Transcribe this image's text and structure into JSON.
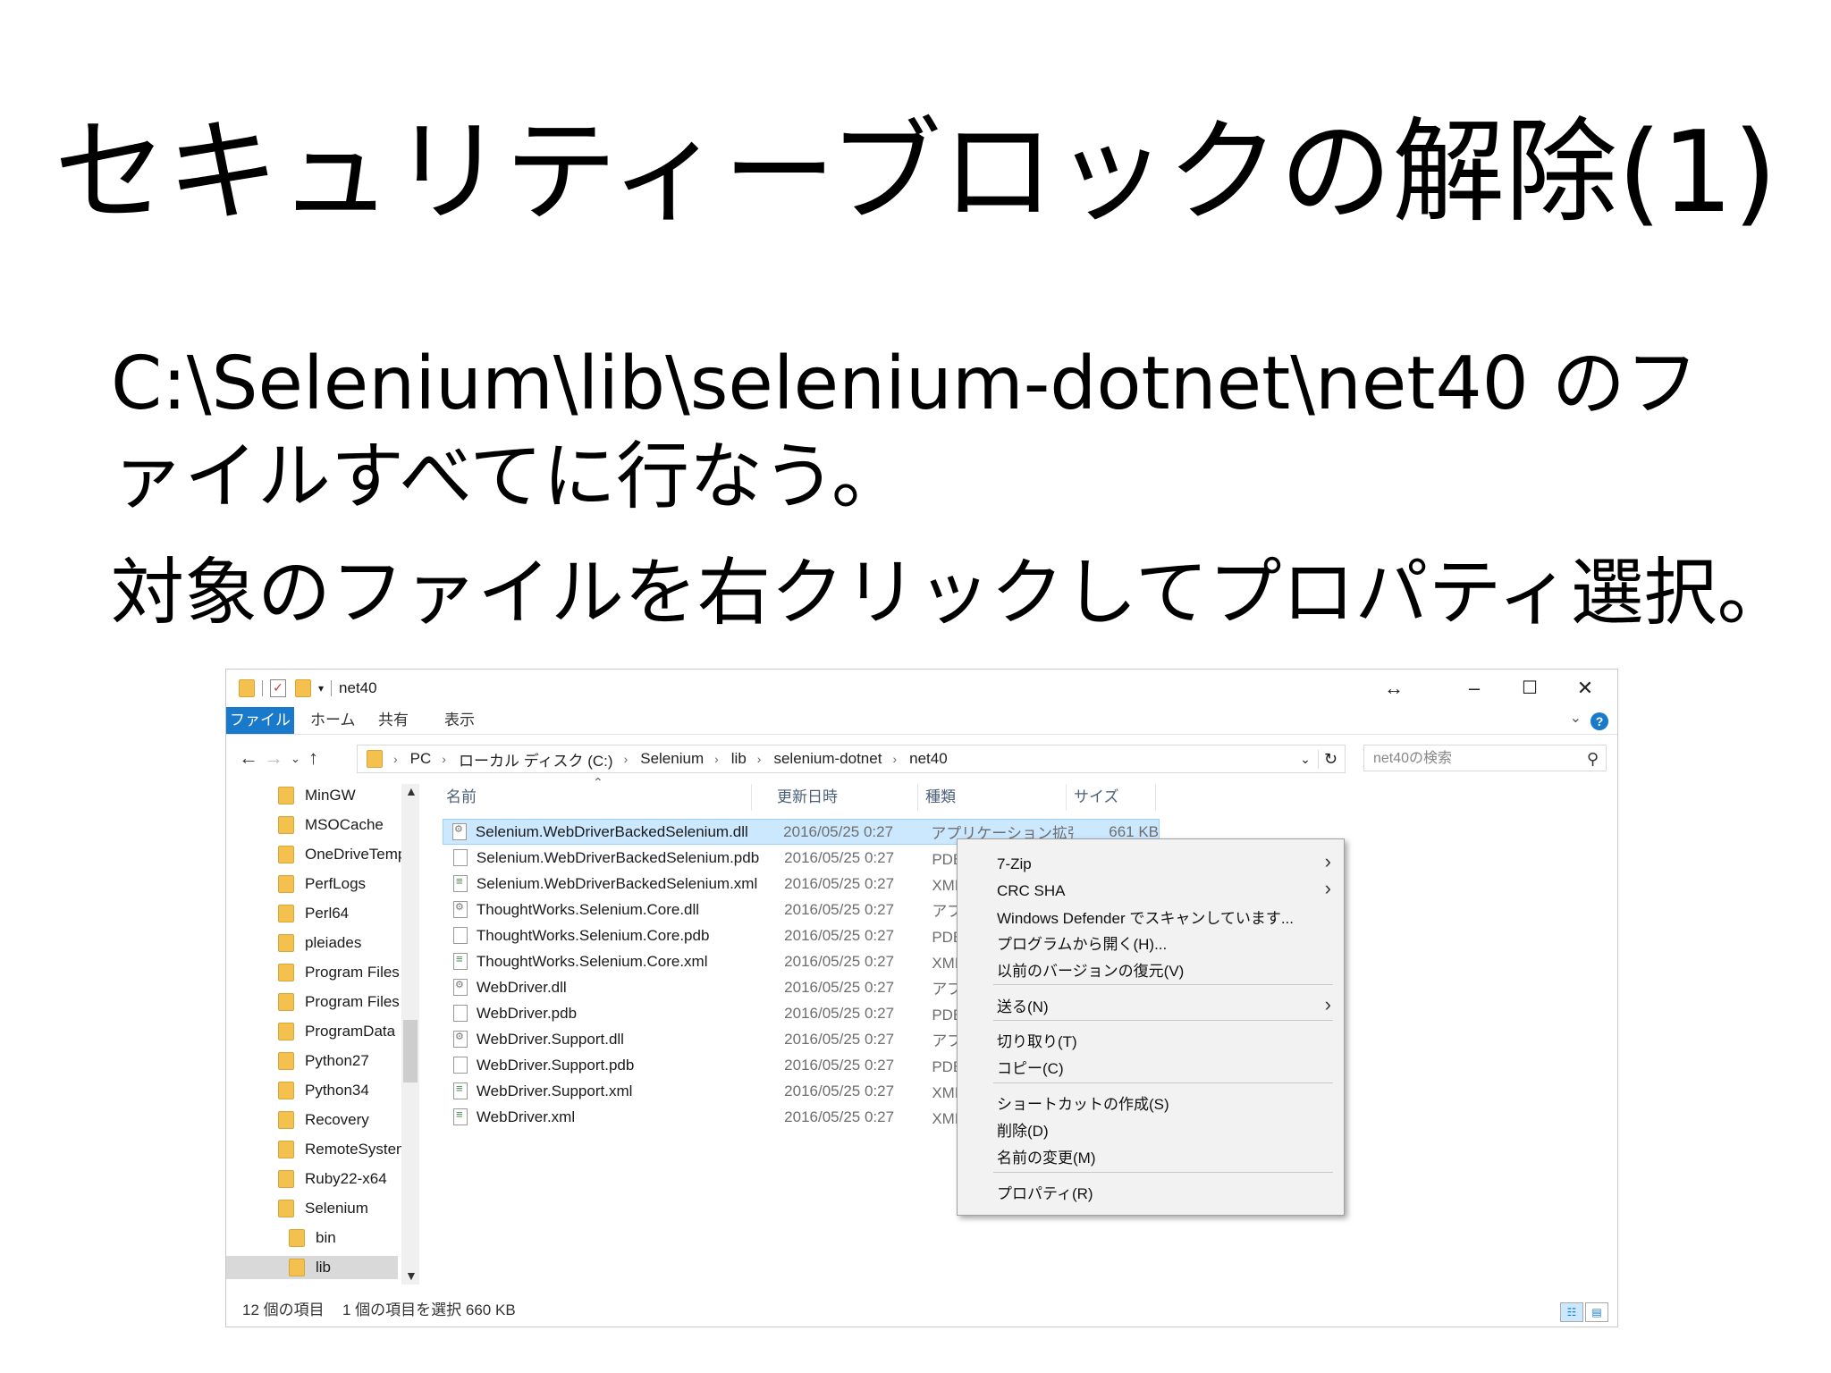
{
  "slide": {
    "title": "セキュリティーブロックの解除(1)",
    "line1": "C:\\Selenium\\lib\\selenium-dotnet\\net40 のファイルすべてに行なう。",
    "line2": "対象のファイルを右クリックしてプロパティ選択。"
  },
  "window": {
    "title": "net40",
    "controls": {
      "resize": "↔",
      "minimize": "–",
      "maximize": "☐",
      "close": "✕"
    },
    "ribbon_tabs": [
      "ファイル",
      "ホーム",
      "共有",
      "表示"
    ],
    "help": "?",
    "address_crumbs": [
      "PC",
      "ローカル ディスク (C:)",
      "Selenium",
      "lib",
      "selenium-dotnet",
      "net40"
    ],
    "search_placeholder": "net40の検索",
    "nav_items": [
      "MinGW",
      "MSOCache",
      "OneDriveTemp",
      "PerfLogs",
      "Perl64",
      "pleiades",
      "Program Files",
      "Program Files (",
      "ProgramData",
      "Python27",
      "Python34",
      "Recovery",
      "RemoteSystem",
      "Ruby22-x64",
      "Selenium",
      "bin",
      "lib"
    ],
    "columns": {
      "name": "名前",
      "date": "更新日時",
      "type": "種類",
      "size": "サイズ"
    },
    "files": [
      {
        "name": "Selenium.WebDriverBackedSelenium.dll",
        "date": "2016/05/25 0:27",
        "type": "アプリケーション拡張",
        "size": "661 KB",
        "icon": "dll-file-icon"
      },
      {
        "name": "Selenium.WebDriverBackedSelenium.pdb",
        "date": "2016/05/25 0:27",
        "type": "PDB フ",
        "size": "",
        "icon": "file-icon"
      },
      {
        "name": "Selenium.WebDriverBackedSelenium.xml",
        "date": "2016/05/25 0:27",
        "type": "XML ト",
        "size": "",
        "icon": "xml-file-icon"
      },
      {
        "name": "ThoughtWorks.Selenium.Core.dll",
        "date": "2016/05/25 0:27",
        "type": "アプリケ",
        "size": "",
        "icon": "dll-file-icon"
      },
      {
        "name": "ThoughtWorks.Selenium.Core.pdb",
        "date": "2016/05/25 0:27",
        "type": "PDB フ",
        "size": "",
        "icon": "file-icon"
      },
      {
        "name": "ThoughtWorks.Selenium.Core.xml",
        "date": "2016/05/25 0:27",
        "type": "XML ト",
        "size": "",
        "icon": "xml-file-icon"
      },
      {
        "name": "WebDriver.dll",
        "date": "2016/05/25 0:27",
        "type": "アプリケ",
        "size": "",
        "icon": "dll-file-icon"
      },
      {
        "name": "WebDriver.pdb",
        "date": "2016/05/25 0:27",
        "type": "PDB フ",
        "size": "",
        "icon": "file-icon"
      },
      {
        "name": "WebDriver.Support.dll",
        "date": "2016/05/25 0:27",
        "type": "アプリケ",
        "size": "",
        "icon": "dll-file-icon"
      },
      {
        "name": "WebDriver.Support.pdb",
        "date": "2016/05/25 0:27",
        "type": "PDB フ",
        "size": "",
        "icon": "file-icon"
      },
      {
        "name": "WebDriver.Support.xml",
        "date": "2016/05/25 0:27",
        "type": "XML ト",
        "size": "",
        "icon": "xml-file-icon"
      },
      {
        "name": "WebDriver.xml",
        "date": "2016/05/25 0:27",
        "type": "XML ト",
        "size": "",
        "icon": "xml-file-icon"
      }
    ],
    "status": {
      "count": "12 個の項目",
      "selection": "1 個の項目を選択  660 KB"
    }
  },
  "context_menu": {
    "items": [
      {
        "label": "7-Zip",
        "submenu": true
      },
      {
        "label": "CRC SHA",
        "submenu": true
      },
      {
        "label": "Windows Defender でスキャンしています...",
        "submenu": false
      },
      {
        "label": "プログラムから開く(H)...",
        "submenu": false
      },
      {
        "label": "以前のバージョンの復元(V)",
        "submenu": false
      },
      {
        "label": "送る(N)",
        "submenu": true
      },
      {
        "label": "切り取り(T)",
        "submenu": false
      },
      {
        "label": "コピー(C)",
        "submenu": false
      },
      {
        "label": "ショートカットの作成(S)",
        "submenu": false
      },
      {
        "label": "削除(D)",
        "submenu": false
      },
      {
        "label": "名前の変更(M)",
        "submenu": false
      },
      {
        "label": "プロパティ(R)",
        "submenu": false
      }
    ]
  },
  "colors": {
    "accent": "#1979ca",
    "selection": "#cce8ff",
    "folder": "#f4c14f"
  }
}
